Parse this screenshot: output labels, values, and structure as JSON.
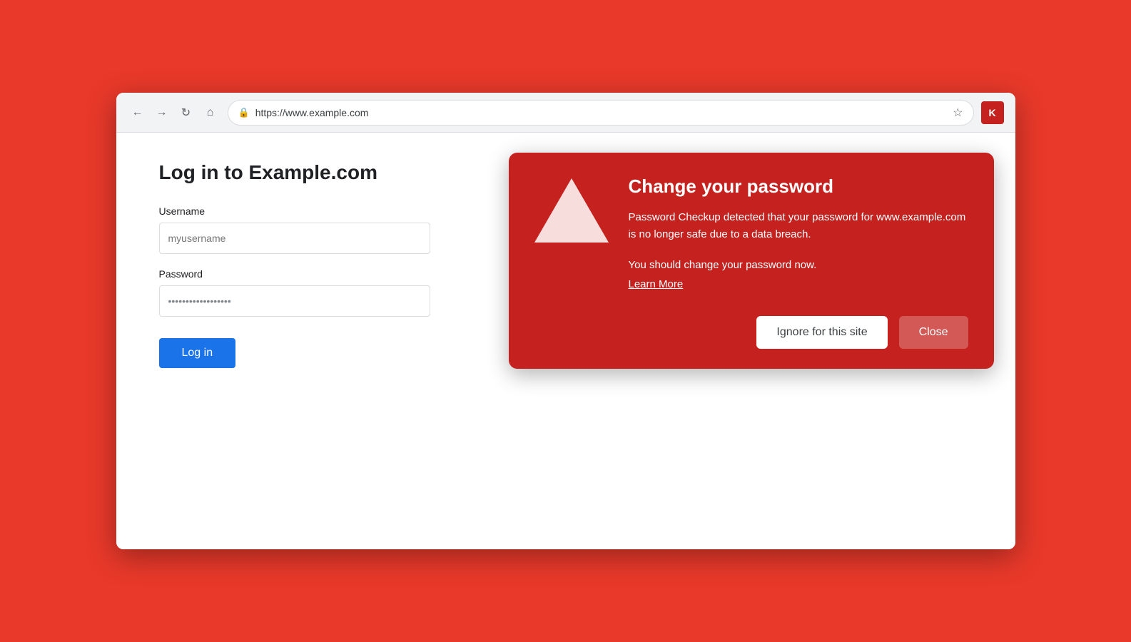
{
  "background_color": "#e8392a",
  "browser": {
    "url": "https://www.example.com",
    "nav": {
      "back_label": "←",
      "forward_label": "→",
      "reload_label": "↻",
      "home_label": "⌂"
    },
    "lock_symbol": "🔒",
    "star_symbol": "☆",
    "extension_icon_label": "K"
  },
  "login_page": {
    "title": "Log in to Example.com",
    "username_label": "Username",
    "username_placeholder": "myusername",
    "password_label": "Password",
    "password_value": "••••••••••••••••••••",
    "login_button_label": "Log in"
  },
  "warning_dialog": {
    "title": "Change your password",
    "body_text": "Password Checkup detected that your password for www.example.com is no longer safe due to a data breach.",
    "change_text": "You should change your password now.",
    "learn_more_label": "Learn More",
    "ignore_button_label": "Ignore for this site",
    "close_button_label": "Close",
    "warning_exclamation": "!"
  }
}
